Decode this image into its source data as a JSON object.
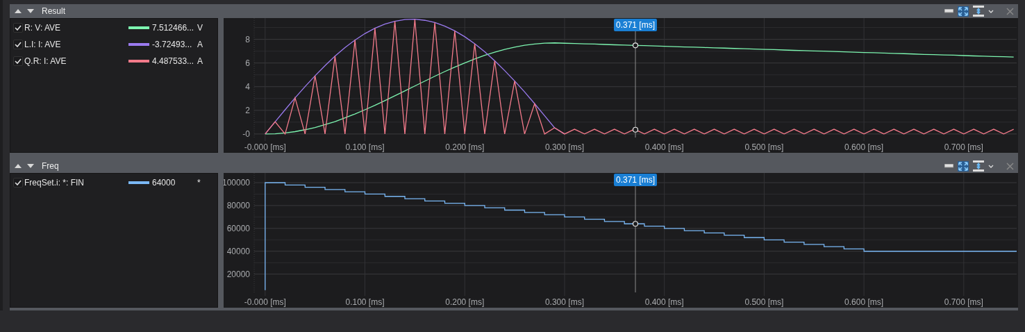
{
  "panels": [
    {
      "title": "Result",
      "legend": [
        {
          "checked": true,
          "value": "7.512466...",
          "unit": "V"
        },
        {
          "checked": true,
          "value": "-3.72493...",
          "unit": "A"
        },
        {
          "checked": true,
          "value": "4.487533...",
          "unit": "A"
        }
      ],
      "chart_data": {
        "type": "line",
        "xlim": [
          -0.011,
          0.753
        ],
        "ylim": [
          -0.3,
          9.8
        ],
        "xticks": [
          {
            "value": 0,
            "label": "-0.000 [ms]"
          },
          {
            "value": 0.1,
            "label": "0.100 [ms]"
          },
          {
            "value": 0.2,
            "label": "0.200 [ms]"
          },
          {
            "value": 0.3,
            "label": "0.300 [ms]"
          },
          {
            "value": 0.4,
            "label": "0.400 [ms]"
          },
          {
            "value": 0.5,
            "label": "0.500 [ms]"
          },
          {
            "value": 0.6,
            "label": "0.600 [ms]"
          },
          {
            "value": 0.7,
            "label": "0.700 [ms]"
          }
        ],
        "yticks": [
          {
            "value": 0,
            "label": "-0"
          },
          {
            "value": 2,
            "label": "2"
          },
          {
            "value": 4,
            "label": "4"
          },
          {
            "value": 6,
            "label": "6"
          },
          {
            "value": 8,
            "label": "8"
          }
        ],
        "x": [
          0,
          0.01,
          0.02,
          0.03,
          0.04,
          0.05,
          0.06,
          0.07,
          0.08,
          0.09,
          0.1,
          0.11,
          0.12,
          0.13,
          0.14,
          0.15,
          0.16,
          0.17,
          0.18,
          0.19,
          0.2,
          0.21,
          0.22,
          0.23,
          0.24,
          0.25,
          0.26,
          0.27,
          0.28,
          0.29,
          0.3,
          0.31,
          0.32,
          0.33,
          0.34,
          0.35,
          0.36,
          0.37,
          0.38,
          0.39,
          0.4,
          0.41,
          0.42,
          0.43,
          0.44,
          0.45,
          0.46,
          0.47,
          0.48,
          0.49,
          0.5,
          0.51,
          0.52,
          0.53,
          0.54,
          0.55,
          0.56,
          0.57,
          0.58,
          0.59,
          0.6,
          0.61,
          0.62,
          0.63,
          0.64,
          0.65,
          0.66,
          0.67,
          0.68,
          0.69,
          0.7,
          0.71,
          0.72,
          0.73,
          0.74,
          0.75
        ],
        "series": [
          {
            "name": "R: V: AVE",
            "color": "#7df5b0",
            "values": [
              0,
              0.02,
              0.09,
              0.2,
              0.36,
              0.55,
              0.79,
              1.05,
              1.36,
              1.69,
              2.05,
              2.42,
              2.82,
              3.23,
              3.64,
              4.06,
              4.47,
              4.88,
              5.28,
              5.65,
              6.01,
              6.34,
              6.65,
              6.91,
              7.15,
              7.34,
              7.5,
              7.61,
              7.68,
              7.7,
              7.67,
              7.65,
              7.62,
              7.6,
              7.57,
              7.54,
              7.52,
              7.49,
              7.47,
              7.44,
              7.41,
              7.39,
              7.36,
              7.34,
              7.31,
              7.28,
              7.26,
              7.23,
              7.21,
              7.18,
              7.15,
              7.13,
              7.1,
              7.07,
              7.05,
              7.02,
              7,
              6.97,
              6.94,
              6.92,
              6.89,
              6.87,
              6.84,
              6.81,
              6.79,
              6.76,
              6.73,
              6.71,
              6.68,
              6.66,
              6.63,
              6.6,
              6.58,
              6.55,
              6.53,
              6.5
            ]
          },
          {
            "name": "L.I: I: AVE",
            "color": "#9b7bf0",
            "values": [
              0,
              1.03,
              2.05,
              3.05,
              4.01,
              4.92,
              5.78,
              6.58,
              7.3,
              7.94,
              8.49,
              8.94,
              9.29,
              9.53,
              9.67,
              9.7,
              9.61,
              9.42,
              9.12,
              8.72,
              8.22,
              7.63,
              6.95,
              6.19,
              5.36,
              4.48,
              3.55,
              2.56,
              1.54,
              0.52,
              0,
              null,
              null,
              null,
              null,
              null,
              null,
              null,
              null,
              null,
              null,
              null,
              null,
              null,
              null,
              null,
              null,
              null,
              null,
              null,
              null,
              null,
              null,
              null,
              null,
              null,
              null,
              null,
              null,
              null,
              null,
              null,
              null,
              null,
              null,
              null,
              null,
              null,
              null,
              null,
              null,
              null,
              null,
              null,
              null,
              null
            ]
          },
          {
            "name": "Q.R: I: AVE",
            "color": "#f27a8a",
            "values": [
              0,
              1.03,
              0,
              3.05,
              0,
              4.92,
              0,
              6.58,
              0,
              7.94,
              0,
              8.94,
              0,
              9.53,
              0,
              9.7,
              0,
              9.42,
              0,
              8.72,
              0,
              7.63,
              0,
              6.19,
              0,
              4.48,
              0,
              2.56,
              0,
              0.52,
              0,
              0.4,
              0,
              0.4,
              0,
              0.4,
              0,
              0.4,
              0,
              0.4,
              0,
              0.4,
              0,
              0.4,
              0,
              0.4,
              0,
              0.4,
              0,
              0.4,
              0,
              0.4,
              0,
              0.4,
              0,
              0.4,
              0,
              0.4,
              0,
              0.4,
              0,
              0.4,
              0,
              0.4,
              0,
              0.4,
              0,
              0.4,
              0,
              0.4,
              0,
              0.4,
              0,
              0.4,
              0,
              0.4
            ]
          }
        ],
        "grid": true,
        "ref_lines": [
          {
            "axis": "x",
            "value": 0.371,
            "label": "0.371 [ms]"
          }
        ]
      }
    },
    {
      "title": "Freq",
      "legend": [
        {
          "checked": true,
          "value": "64000",
          "unit": "*"
        }
      ],
      "chart_data": {
        "type": "line",
        "xlim": [
          -0.011,
          0.753
        ],
        "ylim": [
          4000,
          108500
        ],
        "xticks": [
          {
            "value": 0,
            "label": "-0.000 [ms]"
          },
          {
            "value": 0.1,
            "label": "0.100 [ms]"
          },
          {
            "value": 0.2,
            "label": "0.200 [ms]"
          },
          {
            "value": 0.3,
            "label": "0.300 [ms]"
          },
          {
            "value": 0.4,
            "label": "0.400 [ms]"
          },
          {
            "value": 0.5,
            "label": "0.500 [ms]"
          },
          {
            "value": 0.6,
            "label": "0.600 [ms]"
          },
          {
            "value": 0.7,
            "label": "0.700 [ms]"
          }
        ],
        "yticks": [
          20000,
          40000,
          60000,
          80000,
          100000
        ],
        "x": [
          0,
          0,
          0.02,
          0.04,
          0.06,
          0.08,
          0.1,
          0.12,
          0.14,
          0.16,
          0.18,
          0.2,
          0.22,
          0.24,
          0.26,
          0.28,
          0.3,
          0.32,
          0.34,
          0.36,
          0.38,
          0.4,
          0.42,
          0.44,
          0.46,
          0.48,
          0.5,
          0.52,
          0.54,
          0.56,
          0.58,
          0.6,
          0.62,
          0.64,
          0.66,
          0.68,
          0.7,
          0.72,
          0.74,
          0.753
        ],
        "series": [
          {
            "name": "FreqSet.i: *: FIN",
            "color": "#7ab8f5",
            "values": [
              6000,
              100000,
              98000,
              96000,
              94000,
              92000,
              90000,
              88000,
              86000,
              84000,
              82000,
              80000,
              78000,
              76000,
              74000,
              72000,
              70000,
              68000,
              66000,
              64000,
              62000,
              60000,
              58000,
              56000,
              54000,
              52000,
              50000,
              48000,
              46000,
              44000,
              42000,
              40000,
              40000,
              40000,
              40000,
              40000,
              40000,
              40000,
              40000,
              40000
            ]
          }
        ],
        "grid": true,
        "ref_lines": [
          {
            "axis": "x",
            "value": 0.371,
            "label": "0.371 [ms]"
          }
        ]
      }
    }
  ]
}
